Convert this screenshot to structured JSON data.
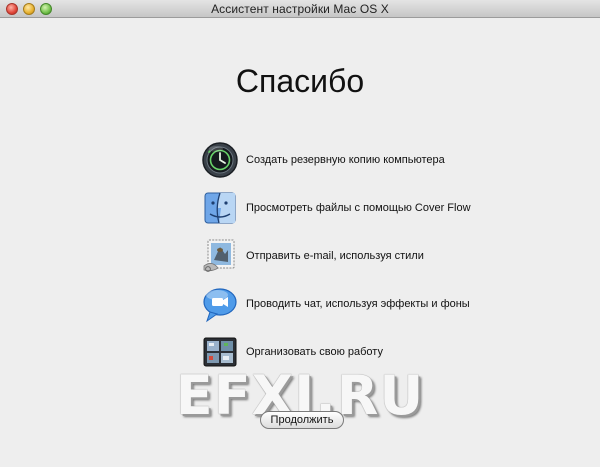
{
  "window": {
    "title": "Ассистент настройки Mac OS X"
  },
  "main": {
    "heading": "Спасибо",
    "features": [
      {
        "label": "Создать резервную копию компьютера",
        "icon": "time-machine-icon"
      },
      {
        "label": "Просмотреть файлы с помощью Cover Flow",
        "icon": "finder-icon"
      },
      {
        "label": "Отправить e-mail, используя стили",
        "icon": "mail-icon"
      },
      {
        "label": "Проводить чат, используя эффекты и фоны",
        "icon": "ichat-icon"
      },
      {
        "label": "Организовать свою работу",
        "icon": "spaces-icon"
      }
    ],
    "continue_label": "Продолжить"
  },
  "watermark": "EFXI.RU",
  "colors": {
    "window_bg": "#eeeeee",
    "titlebar": "#d2d2d2",
    "close": "#e0463a",
    "minimize": "#e7b12f",
    "zoom": "#71c04a"
  }
}
